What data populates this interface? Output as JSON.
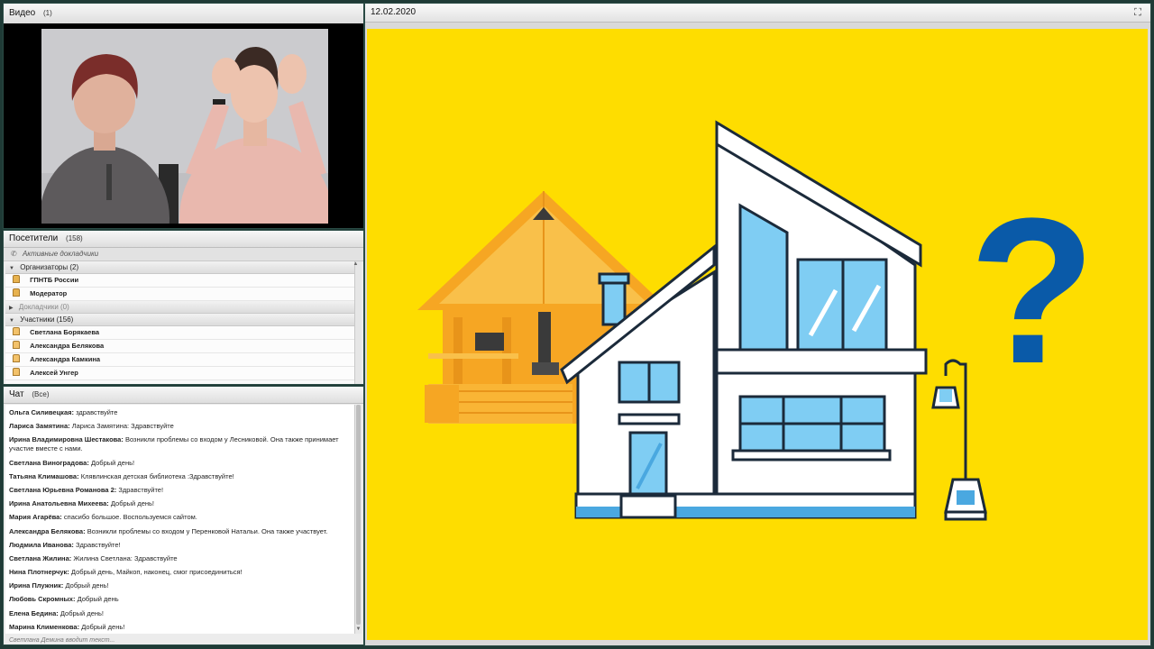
{
  "video": {
    "title": "Видео",
    "count": "(1)"
  },
  "attendees": {
    "title": "Посетители",
    "count": "(158)",
    "active_speakers": "Активные докладчики",
    "groups": [
      {
        "label": "Организаторы (2)",
        "expanded": true,
        "people": [
          "ГПНТБ России",
          "Модератор"
        ]
      },
      {
        "label": "Докладчики (0)",
        "expanded": false,
        "people": []
      },
      {
        "label": "Участники (156)",
        "expanded": true,
        "people": [
          "Светлана Борякаева",
          "Александра Белякова",
          "Александра Камкина",
          "Алексей Унгер"
        ]
      }
    ]
  },
  "chat": {
    "title": "Чат",
    "scope": "(Все)",
    "messages": [
      {
        "sender": "Ольга Силивецкая:",
        "text": "здравствуйте"
      },
      {
        "sender": "Лариса Замятина:",
        "text": "Лариса Замятина: Здравствуйте"
      },
      {
        "sender": "Ирина Владимировна Шестакова:",
        "text": "Возникли проблемы со входом у Лесниковой.  Она также принимает участие вместе с нами."
      },
      {
        "sender": "Светлана  Виноградова:",
        "text": "Добрый день!"
      },
      {
        "sender": "Татьяна Климашова:",
        "text": "Клявлинская детская библиотека :Здравствуйте!"
      },
      {
        "sender": "Светлана Юрьевна Романова 2:",
        "text": "Здравствуйте!"
      },
      {
        "sender": "Ирина Анатольевна Михеева:",
        "text": "Добрый день!"
      },
      {
        "sender": "Мария Агарёва:",
        "text": "спасибо большое. Воспользуемся сайтом."
      },
      {
        "sender": "Александра Белякова:",
        "text": "Возникли проблемы со входом у Перенковой Натальи. Она также участвует."
      },
      {
        "sender": "Людмила Иванова:",
        "text": "Здравствуйте!"
      },
      {
        "sender": "Светлана Жилина:",
        "text": "Жилина Светлана: Здравствуйте"
      },
      {
        "sender": "Нина Плотнерчук:",
        "text": "Добрый день, Майкоп, наконец, смог присоединиться!"
      },
      {
        "sender": "Ирина Плужник:",
        "text": "Добрый день!"
      },
      {
        "sender": "Любовь Скромных:",
        "text": "Добрый день"
      },
      {
        "sender": "Елена Бедина:",
        "text": "Добрый день!"
      },
      {
        "sender": "Марина Клименкова:",
        "text": "Добрый день!"
      }
    ],
    "typing": "Светлана Демина вводит текст..."
  },
  "share": {
    "title": "12.02.2020",
    "slide": {
      "background": "#fedd00",
      "question_mark": "?",
      "accent_color": "#0a5aa8",
      "icons": [
        "wooden-house",
        "modern-house",
        "street-lamp"
      ]
    }
  },
  "icons": [
    "speaker-icon",
    "host-icon",
    "attendee-icon",
    "fullscreen-icon"
  ]
}
